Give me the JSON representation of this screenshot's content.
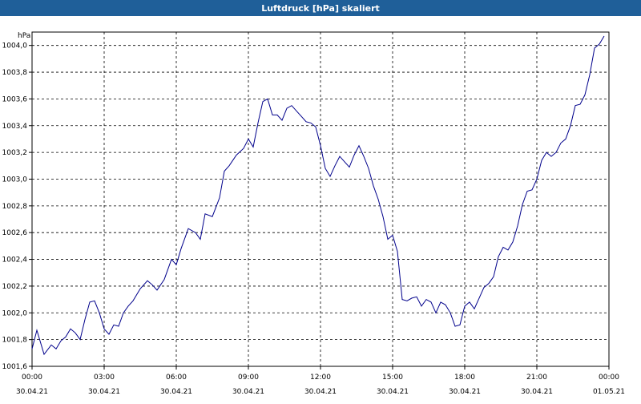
{
  "window": {
    "title": "Luftdruck [hPa] skaliert"
  },
  "chart_data": {
    "type": "line",
    "title": "Luftdruck [hPa] skaliert",
    "unit_label": "hPa",
    "ylim": [
      1001.6,
      1004.1
    ],
    "y_ticks": [
      {
        "value": 1001.6,
        "label": "1001,6"
      },
      {
        "value": 1001.8,
        "label": "1001,8"
      },
      {
        "value": 1002.0,
        "label": "1002,0"
      },
      {
        "value": 1002.2,
        "label": "1002,2"
      },
      {
        "value": 1002.4,
        "label": "1002,4"
      },
      {
        "value": 1002.6,
        "label": "1002,6"
      },
      {
        "value": 1002.8,
        "label": "1002,8"
      },
      {
        "value": 1003.0,
        "label": "1003,0"
      },
      {
        "value": 1003.2,
        "label": "1003,2"
      },
      {
        "value": 1003.4,
        "label": "1003,4"
      },
      {
        "value": 1003.6,
        "label": "1003,6"
      },
      {
        "value": 1003.8,
        "label": "1003,8"
      },
      {
        "value": 1004.0,
        "label": "1004,0"
      }
    ],
    "x_ticks": [
      {
        "time": "00:00",
        "date": "30.04.21"
      },
      {
        "time": "03:00",
        "date": "30.04.21"
      },
      {
        "time": "06:00",
        "date": "30.04.21"
      },
      {
        "time": "09:00",
        "date": "30.04.21"
      },
      {
        "time": "12:00",
        "date": "30.04.21"
      },
      {
        "time": "15:00",
        "date": "30.04.21"
      },
      {
        "time": "18:00",
        "date": "30.04.21"
      },
      {
        "time": "21:00",
        "date": "30.04.21"
      },
      {
        "time": "00:00",
        "date": "01.05.21"
      }
    ],
    "grid": true,
    "series": [
      {
        "color": "#00008b",
        "hours": [
          0,
          0.2,
          0.5,
          0.8,
          1.0,
          1.2,
          1.4,
          1.6,
          1.8,
          2.0,
          2.2,
          2.4,
          2.6,
          2.8,
          3.0,
          3.2,
          3.4,
          3.6,
          3.8,
          4.0,
          4.2,
          4.5,
          4.8,
          5.0,
          5.2,
          5.5,
          5.8,
          6.0,
          6.2,
          6.5,
          6.8,
          7.0,
          7.2,
          7.5,
          7.8,
          8.0,
          8.2,
          8.5,
          8.8,
          9.0,
          9.2,
          9.4,
          9.6,
          9.8,
          10.0,
          10.2,
          10.4,
          10.6,
          10.8,
          11.0,
          11.2,
          11.4,
          11.6,
          11.8,
          12.0,
          12.2,
          12.4,
          12.6,
          12.8,
          13.0,
          13.2,
          13.4,
          13.6,
          13.8,
          14.0,
          14.2,
          14.4,
          14.6,
          14.8,
          15.0,
          15.2,
          15.4,
          15.6,
          15.8,
          16.0,
          16.2,
          16.4,
          16.6,
          16.8,
          17.0,
          17.2,
          17.4,
          17.6,
          17.8,
          18.0,
          18.2,
          18.4,
          18.6,
          18.8,
          19.0,
          19.2,
          19.4,
          19.6,
          19.8,
          20.0,
          20.2,
          20.4,
          20.6,
          20.8,
          21.0,
          21.2,
          21.4,
          21.6,
          21.8,
          22.0,
          22.2,
          22.4,
          22.6,
          22.8,
          23.0,
          23.2,
          23.4,
          23.6,
          23.8,
          24.0
        ],
        "values": [
          1001.73,
          1001.87,
          1001.69,
          1001.76,
          1001.73,
          1001.79,
          1001.82,
          1001.88,
          1001.85,
          1001.8,
          1001.95,
          1002.08,
          1002.09,
          1002.0,
          1001.88,
          1001.84,
          1001.91,
          1001.9,
          1002.0,
          1002.05,
          1002.09,
          1002.18,
          1002.24,
          1002.21,
          1002.17,
          1002.25,
          1002.4,
          1002.36,
          1002.48,
          1002.63,
          1002.6,
          1002.55,
          1002.74,
          1002.72,
          1002.86,
          1003.06,
          1003.1,
          1003.18,
          1003.23,
          1003.3,
          1003.24,
          1003.42,
          1003.58,
          1003.6,
          1003.48,
          1003.48,
          1003.44,
          1003.53,
          1003.55,
          1003.51,
          1003.47,
          1003.43,
          1003.42,
          1003.39,
          1003.25,
          1003.08,
          1003.02,
          1003.1,
          1003.17,
          1003.13,
          1003.09,
          1003.18,
          1003.25,
          1003.17,
          1003.08,
          1002.95,
          1002.85,
          1002.72,
          1002.55,
          1002.58,
          1002.46,
          1002.1,
          1002.09,
          1002.11,
          1002.12,
          1002.05,
          1002.1,
          1002.08,
          1002.0,
          1002.08,
          1002.06,
          1002.0,
          1001.9,
          1001.91,
          1002.05,
          1002.08,
          1002.03,
          1002.11,
          1002.19,
          1002.22,
          1002.27,
          1002.42,
          1002.49,
          1002.47,
          1002.53,
          1002.65,
          1002.81,
          1002.91,
          1002.92,
          1003.0,
          1003.14,
          1003.2,
          1003.17,
          1003.2,
          1003.27,
          1003.3,
          1003.4,
          1003.55,
          1003.56,
          1003.63,
          1003.78,
          1003.98,
          1004.01,
          1004.07
        ]
      }
    ]
  }
}
